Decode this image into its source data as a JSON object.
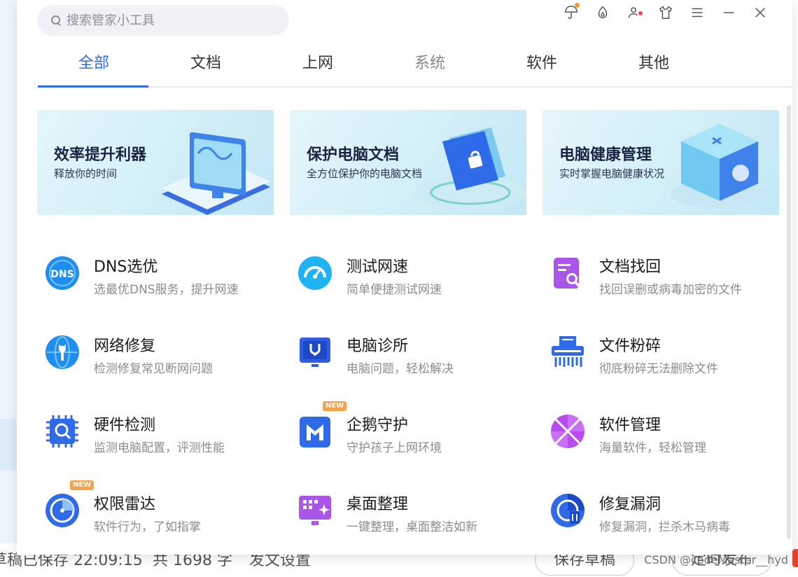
{
  "search": {
    "placeholder": "搜索管家小工具"
  },
  "tabs": [
    {
      "label": "全部",
      "state": "active"
    },
    {
      "label": "文档",
      "state": "normal"
    },
    {
      "label": "上网",
      "state": "normal"
    },
    {
      "label": "系统",
      "state": "disabled"
    },
    {
      "label": "软件",
      "state": "normal"
    },
    {
      "label": "其他",
      "state": "normal"
    }
  ],
  "banners": [
    {
      "title": "效率提升利器",
      "subtitle": "释放你的时间"
    },
    {
      "title": "保护电脑文档",
      "subtitle": "全方位保护你的电脑文档"
    },
    {
      "title": "电脑健康管理",
      "subtitle": "实时掌握电脑健康状况"
    }
  ],
  "tools": [
    {
      "name": "DNS选优",
      "desc": "选最优DNS服务，提升网速",
      "icon": "dns-icon"
    },
    {
      "name": "测试网速",
      "desc": "简单便捷测试网速",
      "icon": "speedometer-icon"
    },
    {
      "name": "文档找回",
      "desc": "找回误删或病毒加密的文件",
      "icon": "document-search-icon"
    },
    {
      "name": "网络修复",
      "desc": "检测修复常见断网问题",
      "icon": "network-wrench-icon"
    },
    {
      "name": "电脑诊所",
      "desc": "电脑问题，轻松解决",
      "icon": "stethoscope-monitor-icon"
    },
    {
      "name": "文件粉碎",
      "desc": "彻底粉碎无法删除文件",
      "icon": "shredder-icon"
    },
    {
      "name": "硬件检测",
      "desc": "监测电脑配置，评测性能",
      "icon": "chip-search-icon"
    },
    {
      "name": "企鹅守护",
      "desc": "守护孩子上网环境",
      "icon": "shield-m-icon",
      "badge": "NEW"
    },
    {
      "name": "软件管理",
      "desc": "海量软件，轻松管理",
      "icon": "app-manager-icon"
    },
    {
      "name": "权限雷达",
      "desc": "软件行为，了如指掌",
      "icon": "radar-icon",
      "badge": "NEW"
    },
    {
      "name": "桌面整理",
      "desc": "一键整理，桌面整洁如新",
      "icon": "desktop-grid-icon"
    },
    {
      "name": "修复漏洞",
      "desc": "修复漏洞，拦杀木马病毒",
      "icon": "vulnerability-fix-icon"
    }
  ],
  "background_app": {
    "status_text": "草稿已保存 22:09:15",
    "word_count": "共 1698 字",
    "publish_settings": "发文设置",
    "save_draft": "保存草稿",
    "publish": "定时发布",
    "watermark": "CSDN @codeMaster__hyd"
  },
  "colors": {
    "accent": "#2f6ae8",
    "badge": "#f5a34a"
  }
}
